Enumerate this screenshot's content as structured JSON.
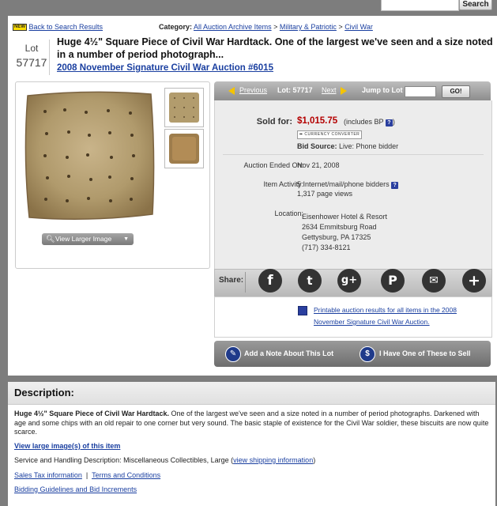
{
  "search": {
    "button_label": "Search",
    "input_value": ""
  },
  "header": {
    "new_badge": "NEW",
    "back_link": "Back to Search Results",
    "category_label": "Category:",
    "breadcrumb": [
      "All Auction Archive Items",
      "Military & Patriotic",
      "Civil War"
    ],
    "breadcrumb_sep": ">"
  },
  "lot": {
    "label": "Lot",
    "number": "57717",
    "title": "Huge 4½\" Square Piece of Civil War Hardtack. One of the largest we've seen and a size noted in a number of period photograph...",
    "auction_link": "2008 November Signature Civil War Auction #6015"
  },
  "image_panel": {
    "view_larger_label": "View Larger Image"
  },
  "nav": {
    "previous_label": "Previous",
    "lot_label": "Lot: 57717",
    "next_label": "Next",
    "jump_label": "Jump to Lot",
    "jump_value": "",
    "go_label": "GO!"
  },
  "sale": {
    "sold_for_label": "Sold for:",
    "price": "$1,015.75",
    "bp_note": "(includes BP",
    "bp_note_close": ")",
    "help_icon": "?",
    "currency_converter_label": "CURRENCY CONVERTER",
    "bid_source_label": "Bid Source:",
    "bid_source_value": "Live: Phone bidder",
    "auction_ended_label": "Auction Ended On:",
    "auction_ended_value": "Nov 21, 2008",
    "activity_label": "Item Activity:",
    "activity_bidders": "5 Internet/mail/phone bidders",
    "activity_views": "1,317 page views",
    "location_label": "Location:",
    "location_lines": [
      "Eisenhower Hotel & Resort",
      "2634 Emmitsburg Road",
      "Gettysburg, PA 17325",
      "(717) 334-8121"
    ]
  },
  "share": {
    "label": "Share:",
    "buttons": [
      {
        "name": "facebook-icon",
        "glyph": "f"
      },
      {
        "name": "twitter-icon",
        "glyph": "t"
      },
      {
        "name": "google-plus-icon",
        "glyph": "g+"
      },
      {
        "name": "pinterest-icon",
        "glyph": "P"
      },
      {
        "name": "email-icon",
        "glyph": "✉"
      },
      {
        "name": "more-share-icon",
        "glyph": "+"
      }
    ]
  },
  "printable": {
    "link_text": "Printable auction results for all items in the 2008 November Signature Civil War Auction."
  },
  "actions": {
    "add_note_label": "Add a Note About This Lot",
    "sell_label": "I Have One of These to Sell"
  },
  "description": {
    "heading": "Description:",
    "bold_title": "Huge 4½\" Square Piece of Civil War Hardtack.",
    "body": " One of the largest we've seen and a size noted in a number of period photographs. Darkened with age and some chips with an old repair to one corner but very sound. The basic staple of existence for the Civil War soldier, these biscuits are now quite scarce.",
    "view_images_link": "View large image(s) of this item",
    "handling_text": "Service and Handling Description: Miscellaneous Collectibles, Large (",
    "handling_link": "view shipping information",
    "handling_close": ")",
    "sales_tax_link": "Sales Tax information",
    "separator": "|",
    "terms_link": "Terms and Conditions",
    "bidding_link": "Bidding Guidelines and Bid Increments"
  },
  "colors": {
    "price_red": "#b40000",
    "link_blue": "#1a3fa0",
    "nav_arrow": "#f5c400"
  }
}
